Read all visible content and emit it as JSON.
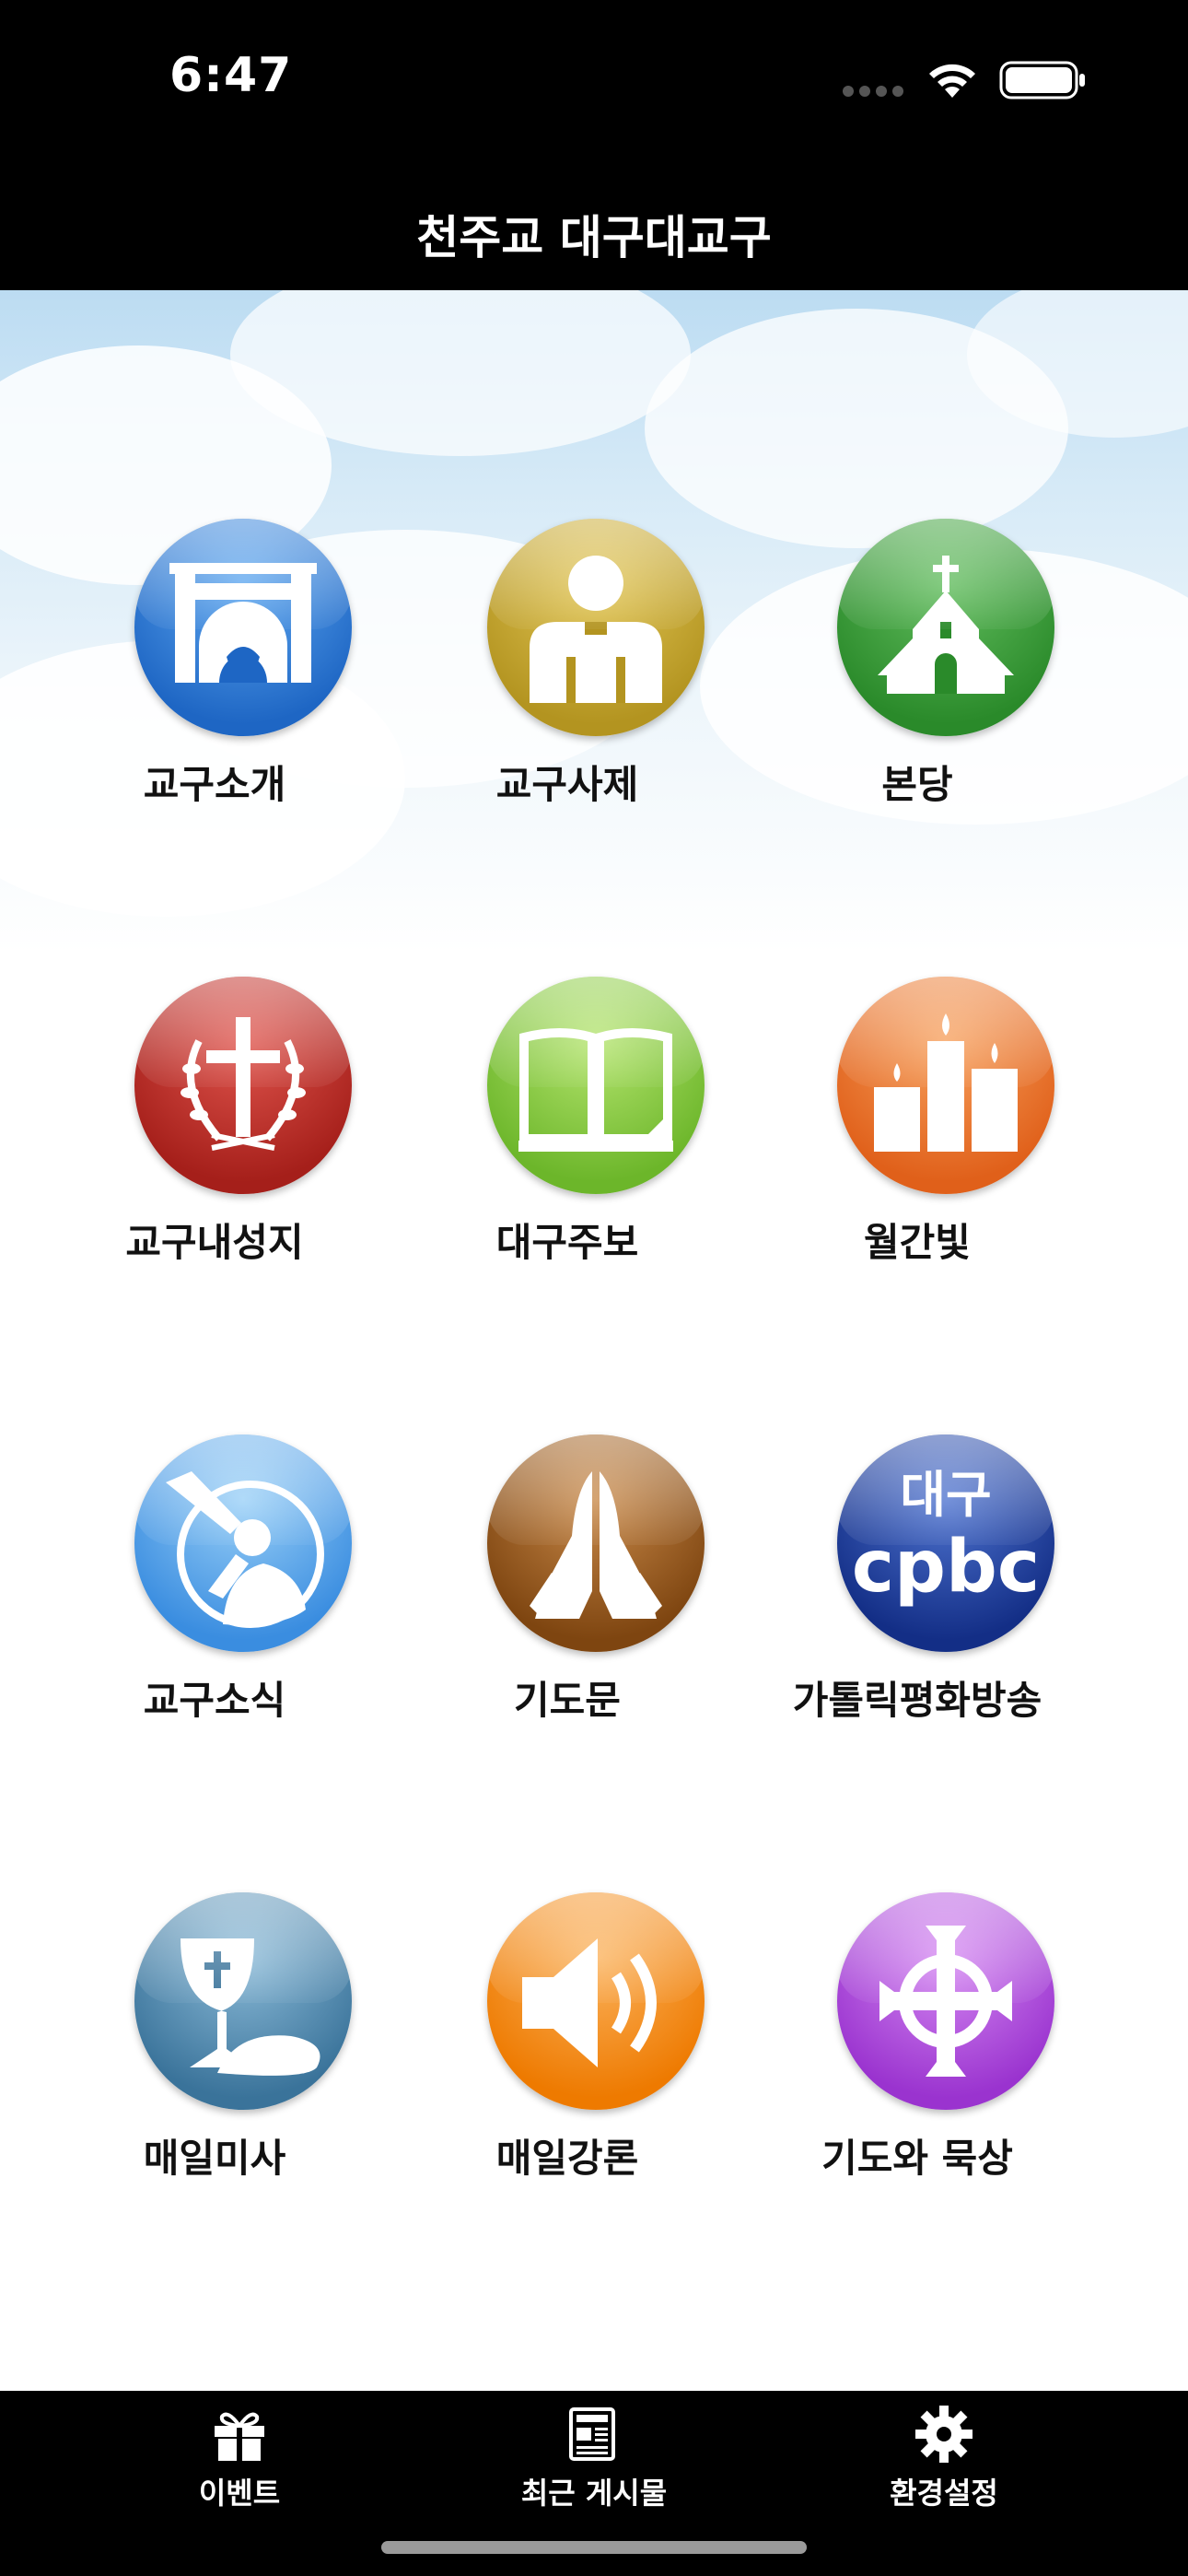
{
  "status": {
    "time": "6:47"
  },
  "header": {
    "title": "천주교 대구대교구"
  },
  "menu": [
    {
      "label": "교구소개",
      "icon": "cathedral-arch-icon",
      "color": "#2f7fd6"
    },
    {
      "label": "교구사제",
      "icon": "priest-icon",
      "color": "#c4a52a"
    },
    {
      "label": "본당",
      "icon": "church-icon",
      "color": "#3a9a3a"
    },
    {
      "label": "교구내성지",
      "icon": "cross-laurel-icon",
      "color": "#c0312b"
    },
    {
      "label": "대구주보",
      "icon": "open-book-icon",
      "color": "#86cc3a"
    },
    {
      "label": "월간빛",
      "icon": "candles-icon",
      "color": "#ef7a2e"
    },
    {
      "label": "교구소식",
      "icon": "trumpet-herald-icon",
      "color": "#5aaeef"
    },
    {
      "label": "기도문",
      "icon": "praying-hands-icon",
      "color": "#9a5a1c"
    },
    {
      "label": "가톨릭평화방송",
      "icon": "cpbc-logo-icon",
      "color": "#1f3e9e",
      "logo_text": [
        "대구",
        "cpbc"
      ]
    },
    {
      "label": "매일미사",
      "icon": "chalice-bread-icon",
      "color": "#4a86ad"
    },
    {
      "label": "매일강론",
      "icon": "speaker-icon",
      "color": "#f58a1a"
    },
    {
      "label": "기도와 묵상",
      "icon": "celtic-cross-icon",
      "color": "#b04ee0"
    }
  ],
  "tabbar": [
    {
      "label": "이벤트",
      "icon": "gift-icon"
    },
    {
      "label": "최근 게시물",
      "icon": "news-icon"
    },
    {
      "label": "환경설정",
      "icon": "gear-icon"
    }
  ]
}
